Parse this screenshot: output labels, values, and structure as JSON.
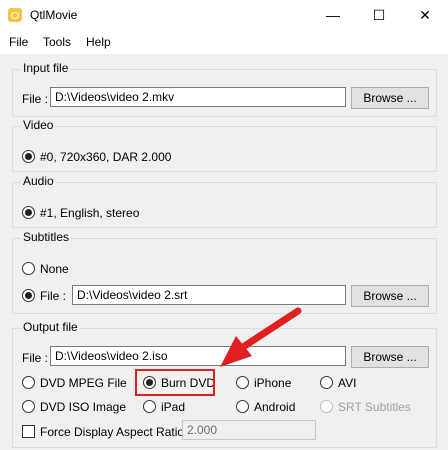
{
  "window": {
    "title": "QtlMovie",
    "minimize": "—",
    "maximize": "☐",
    "close": "✕"
  },
  "menu": [
    "File",
    "Tools",
    "Help"
  ],
  "input_file": {
    "group_label": "Input file",
    "label": "File :",
    "value": "D:\\Videos\\video 2.mkv",
    "browse": "Browse ..."
  },
  "video": {
    "group_label": "Video",
    "option": "#0, 720x360, DAR 2.000"
  },
  "audio": {
    "group_label": "Audio",
    "option": "#1, English, stereo"
  },
  "subtitles": {
    "group_label": "Subtitles",
    "none_label": "None",
    "file_label": "File :",
    "value": "D:\\Videos\\video 2.srt",
    "browse": "Browse ..."
  },
  "output_file": {
    "group_label": "Output file",
    "label": "File :",
    "value": "D:\\Videos\\video 2.iso",
    "browse": "Browse ...",
    "formats": {
      "dvd_mpeg": "DVD MPEG File",
      "burn_dvd": "Burn DVD",
      "iphone": "iPhone",
      "avi": "AVI",
      "dvd_iso": "DVD ISO Image",
      "ipad": "iPad",
      "android": "Android",
      "srt": "SRT Subtitles"
    },
    "selected_format": "Burn DVD",
    "force_aspect_label": "Force Display Aspect Ratio :",
    "force_aspect_value": "2.000"
  },
  "colors": {
    "annotation": "#e02020"
  }
}
